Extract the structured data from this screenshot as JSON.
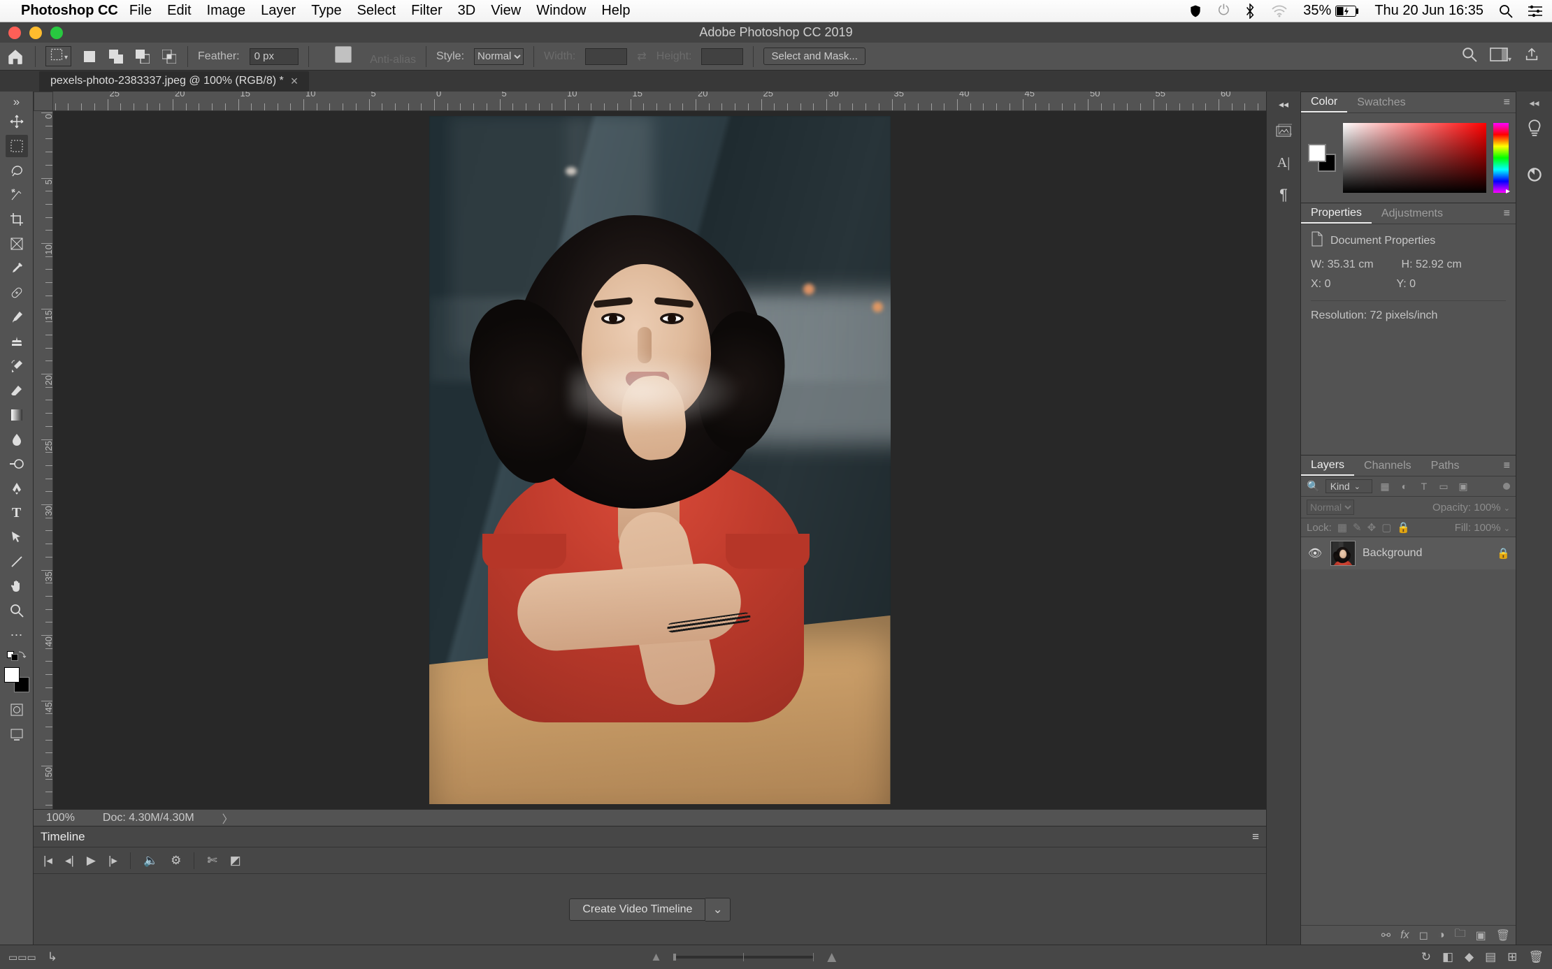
{
  "mac_menu": {
    "app": "Photoshop CC",
    "items": [
      "File",
      "Edit",
      "Image",
      "Layer",
      "Type",
      "Select",
      "Filter",
      "3D",
      "View",
      "Window",
      "Help"
    ],
    "battery_pct": "35%",
    "datetime": "Thu 20 Jun  16:35"
  },
  "app_title": "Adobe Photoshop CC 2019",
  "traffic_light_colors": [
    "#ff5f57",
    "#febc2e",
    "#28c840"
  ],
  "options_bar": {
    "feather_label": "Feather:",
    "feather_value": "0 px",
    "antialias_label": "Anti-alias",
    "style_label": "Style:",
    "style_value": "Normal",
    "width_label": "Width:",
    "height_label": "Height:",
    "select_mask_btn": "Select and Mask..."
  },
  "doc_tab": {
    "title": "pexels-photo-2383337.jpeg @ 100% (RGB/8) *"
  },
  "ruler_h_labels": [
    "25",
    "50",
    "25",
    "20",
    "15",
    "10",
    "5",
    "0",
    "5",
    "10",
    "15",
    "20",
    "25",
    "30",
    "35",
    "40",
    "45",
    "50",
    "55",
    "60"
  ],
  "ruler_v_labels": [
    "0",
    "5",
    "1\n0",
    "1\n5",
    "2\n0",
    "2\n5",
    "3\n0",
    "3\n5",
    "4\n0",
    "4\n5",
    "5\n0"
  ],
  "tools": [
    "move",
    "marquee",
    "lasso",
    "quick-select",
    "crop",
    "frame",
    "eyedropper",
    "healing",
    "brush",
    "clone",
    "history-brush",
    "eraser",
    "gradient",
    "blur",
    "dodge",
    "pen",
    "type",
    "path-select",
    "line",
    "hand",
    "zoom",
    "edit-toolbar"
  ],
  "tool_selected": "marquee",
  "statusbar": {
    "zoom": "100%",
    "doc": "Doc: 4.30M/4.30M"
  },
  "panel_color": {
    "tab1": "Color",
    "tab2": "Swatches"
  },
  "panel_properties": {
    "tab1": "Properties",
    "tab2": "Adjustments",
    "title": "Document Properties",
    "w_label": "W:",
    "w_val": "35.31 cm",
    "h_label": "H:",
    "h_val": "52.92 cm",
    "x_label": "X:",
    "x_val": "0",
    "y_label": "Y:",
    "y_val": "0",
    "res_label": "Resolution:",
    "res_val": "72 pixels/inch"
  },
  "panel_layers": {
    "tab1": "Layers",
    "tab2": "Channels",
    "tab3": "Paths",
    "kind_label": "Kind",
    "blend_mode": "Normal",
    "opacity_label": "Opacity:",
    "opacity_val": "100%",
    "lock_label": "Lock:",
    "fill_label": "Fill:",
    "fill_val": "100%",
    "layer_name": "Background"
  },
  "timeline": {
    "tab": "Timeline",
    "create_btn": "Create Video Timeline"
  },
  "mini_strip_icons": [
    "history-icon",
    "character-icon",
    "paragraph-icon"
  ],
  "right_strip_icons": [
    "libraries-icon",
    "creative-cloud-icon"
  ]
}
